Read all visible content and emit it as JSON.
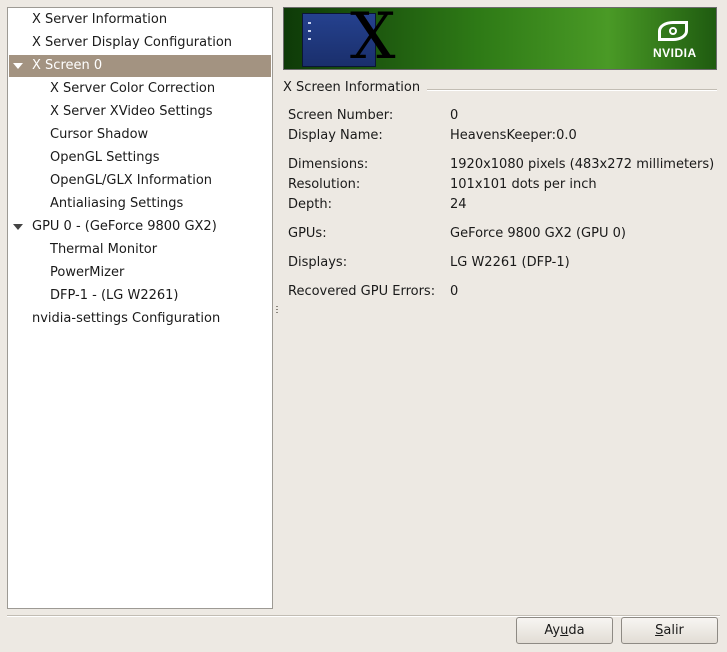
{
  "tree": {
    "items": [
      {
        "label": "X Server Information"
      },
      {
        "label": "X Server Display Configuration"
      },
      {
        "label": "X Screen 0"
      },
      {
        "label": "X Server Color Correction"
      },
      {
        "label": "X Server XVideo Settings"
      },
      {
        "label": "Cursor Shadow"
      },
      {
        "label": "OpenGL Settings"
      },
      {
        "label": "OpenGL/GLX Information"
      },
      {
        "label": "Antialiasing Settings"
      },
      {
        "label": "GPU 0 - (GeForce 9800 GX2)"
      },
      {
        "label": "Thermal Monitor"
      },
      {
        "label": "PowerMizer"
      },
      {
        "label": "DFP-1 - (LG W2261)"
      },
      {
        "label": "nvidia-settings Configuration"
      }
    ]
  },
  "banner": {
    "x_letter": "X",
    "brand": "NVIDIA",
    "brand_color": "#3f8f1f"
  },
  "section": {
    "title": "X Screen Information",
    "rows": [
      {
        "label": "Screen Number:",
        "value": "0"
      },
      {
        "label": "Display Name:",
        "value": "HeavensKeeper:0.0"
      },
      {
        "label": "Dimensions:",
        "value": "1920x1080 pixels (483x272 millimeters)"
      },
      {
        "label": "Resolution:",
        "value": "101x101 dots per inch"
      },
      {
        "label": "Depth:",
        "value": "24"
      },
      {
        "label": "GPUs:",
        "value": "GeForce 9800 GX2 (GPU 0)"
      },
      {
        "label": "Displays:",
        "value": "LG W2261 (DFP-1)"
      },
      {
        "label": "Recovered GPU Errors:",
        "value": "0"
      }
    ]
  },
  "buttons": {
    "help": {
      "pre": "Ay",
      "mn": "u",
      "post": "da"
    },
    "quit": {
      "pre": "",
      "mn": "S",
      "post": "alir"
    }
  },
  "colors": {
    "selection": "#a39381",
    "window_bg": "#ede9e3"
  }
}
